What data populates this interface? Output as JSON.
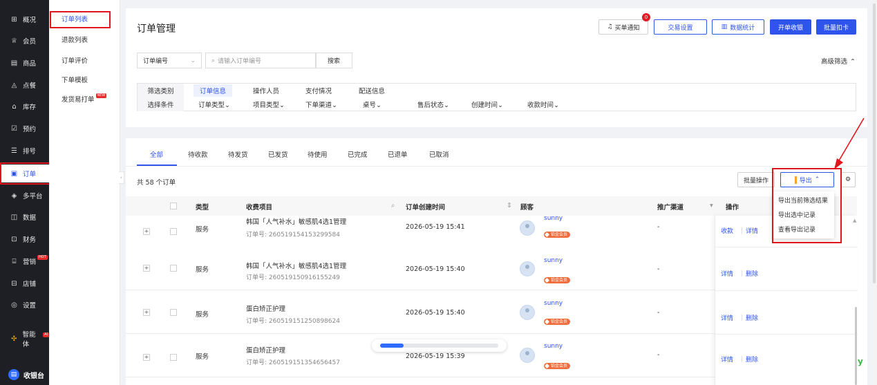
{
  "sidebar": {
    "items": [
      {
        "label": "概况",
        "icon": "grid-icon"
      },
      {
        "label": "会员",
        "icon": "member-icon"
      },
      {
        "label": "商品",
        "icon": "goods-icon"
      },
      {
        "label": "点餐",
        "icon": "order-food-icon"
      },
      {
        "label": "库存",
        "icon": "stock-icon"
      },
      {
        "label": "预约",
        "icon": "reserve-icon"
      },
      {
        "label": "排号",
        "icon": "queue-icon"
      },
      {
        "label": "订单",
        "icon": "order-icon"
      },
      {
        "label": "多平台",
        "icon": "layers-icon"
      },
      {
        "label": "数据",
        "icon": "chart-icon"
      },
      {
        "label": "财务",
        "icon": "finance-icon"
      },
      {
        "label": "营销",
        "icon": "gift-icon",
        "badge": "HOT"
      },
      {
        "label": "店铺",
        "icon": "store-icon"
      },
      {
        "label": "设置",
        "icon": "settings-icon"
      },
      {
        "label": "智能体",
        "icon": "agent-icon",
        "badge": "AI"
      }
    ],
    "cashier": "收银台"
  },
  "submenu": {
    "items": [
      {
        "label": "订单列表"
      },
      {
        "label": "退款列表"
      },
      {
        "label": "订单评价"
      },
      {
        "label": "下单模板"
      },
      {
        "label": "发货易打单",
        "badge": "NEW"
      }
    ]
  },
  "header": {
    "title": "订单管理",
    "notify_label": "买单通知",
    "notify_count": "0",
    "trade_settings": "交易设置",
    "stats": "数据统计",
    "open_cashier": "开单收银",
    "batch_deduct": "批量扣卡"
  },
  "search": {
    "field_select": "订单编号",
    "placeholder": "请输入订单编号",
    "button": "搜索",
    "advanced": "高级筛选"
  },
  "filter": {
    "row1_label": "筛选类别",
    "row2_label": "选择条件",
    "categories": [
      "订单信息",
      "操作人员",
      "支付情况",
      "配送信息"
    ],
    "conditions": [
      "订单类型",
      "项目类型",
      "下单渠道",
      "桌号",
      "售后状态",
      "创建时间",
      "收款时间"
    ]
  },
  "tabs": [
    "全部",
    "待收款",
    "待发货",
    "已发货",
    "待使用",
    "已完成",
    "已退单",
    "已取消"
  ],
  "count_text": "共 58 个订单",
  "toolbar": {
    "batch": "批量操作",
    "export": "导出"
  },
  "export_menu": [
    "导出当前筛选结果",
    "导出选中记录",
    "查看导出记录"
  ],
  "table": {
    "headers": {
      "type": "类型",
      "item": "收费项目",
      "created": "订单创建时间",
      "customer": "顾客",
      "channel": "推广渠道",
      "ops": "操作"
    },
    "rows": [
      {
        "type": "服务",
        "item": "韩国「人气补水」敏感肌4选1管理",
        "order_no": "订单号: 260519154153299584",
        "time": "2026-05-19 15:41",
        "customer": "sunny",
        "vip": "铂金会员",
        "channel": "-",
        "ops": [
          "收款",
          "详情"
        ]
      },
      {
        "type": "服务",
        "item": "韩国「人气补水」敏感肌4选1管理",
        "order_no": "订单号: 260519150916155249",
        "time": "2026-05-19 15:40",
        "customer": "sunny",
        "vip": "铂金会员",
        "channel": "-",
        "ops": [
          "详情",
          "删除"
        ]
      },
      {
        "type": "服务",
        "item": "蛋白矫正护理",
        "order_no": "订单号: 260519151250898624",
        "time": "2026-05-19 15:40",
        "customer": "sunny",
        "vip": "铂金会员",
        "channel": "-",
        "ops": [
          "详情",
          "删除"
        ]
      },
      {
        "type": "服务",
        "item": "蛋白矫正护理",
        "order_no": "订单号: 260519151354656457",
        "time": "2026-05-19 15:39",
        "customer": "sunny",
        "vip": "铂金会员",
        "channel": "-",
        "ops": [
          "详情",
          "删除"
        ]
      }
    ]
  },
  "loading_progress": 0.2,
  "colors": {
    "accent": "#2f54eb",
    "highlight": "#e0161c",
    "sidebar_bg": "#1e1f24"
  }
}
